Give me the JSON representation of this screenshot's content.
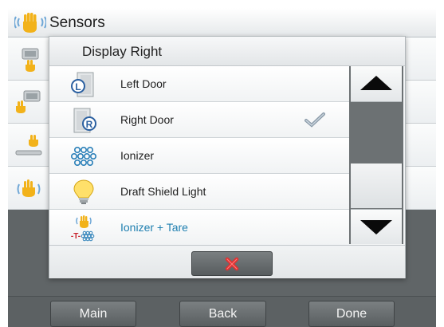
{
  "header": {
    "title": "Sensors"
  },
  "dialog": {
    "title": "Display Right",
    "items": [
      {
        "label": "Left Door",
        "icon": "left-door-icon",
        "checked": false
      },
      {
        "label": "Right Door",
        "icon": "right-door-icon",
        "checked": true
      },
      {
        "label": "Ionizer",
        "icon": "ionizer-icon",
        "checked": false
      },
      {
        "label": "Draft Shield Light",
        "icon": "light-bulb-icon",
        "checked": false
      },
      {
        "label": "Ionizer + Tare",
        "icon": "ionizer-tare-icon",
        "checked": false
      }
    ],
    "cancel_icon": "close-icon"
  },
  "nav": {
    "main": "Main",
    "back": "Back",
    "done": "Done"
  },
  "colors": {
    "accent_text": "#1f7fb0",
    "hand": "#f2b21a",
    "cancel_x": "#e03030"
  }
}
